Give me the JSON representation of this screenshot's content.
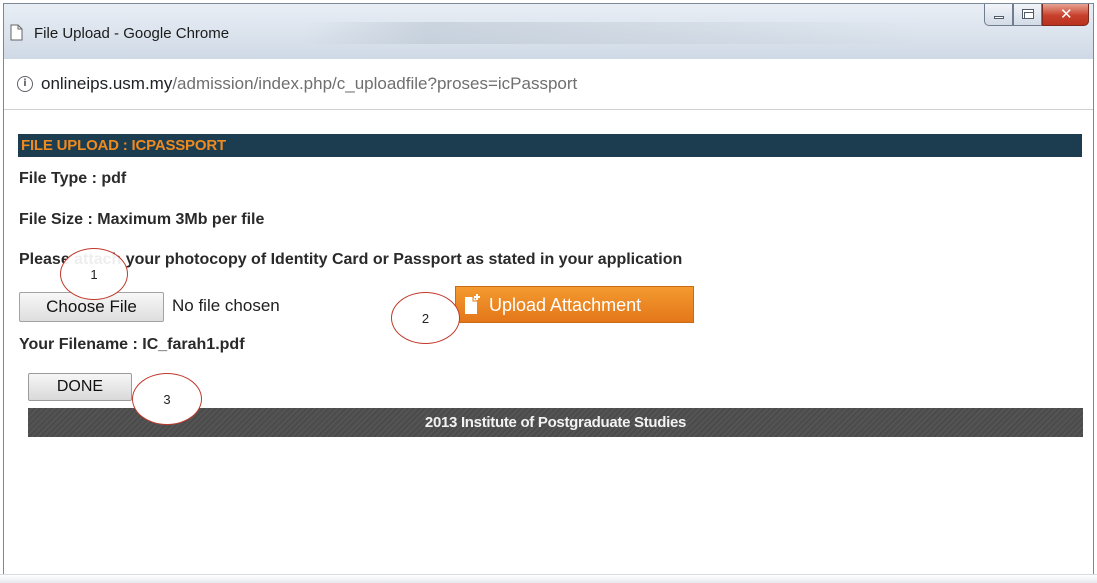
{
  "window": {
    "title": "File Upload - Google Chrome"
  },
  "address_bar": {
    "domain": "onlineips.usm.my",
    "path": "/admission/index.php/c_uploadfile?proses=icPassport"
  },
  "upload_form": {
    "header": "FILE UPLOAD : ICPASSPORT",
    "file_type": "File Type : pdf",
    "file_size": "File Size : Maximum 3Mb per file",
    "instruction": "Please attach your photocopy of Identity Card or Passport as stated in your application",
    "choose_file_label": "Choose File",
    "no_file_text": "No file chosen",
    "upload_label": "Upload Attachment",
    "filename_line": "Your Filename : IC_farah1.pdf",
    "done_label": "DONE"
  },
  "footer": {
    "text": "2013 Institute of Postgraduate Studies"
  },
  "callouts": [
    "1",
    "2",
    "3"
  ],
  "colors": {
    "header_bg": "#1c3c50",
    "header_text": "#ee8a1e",
    "upload_button": "#f0891f",
    "footer_bg": "#4b4b4b",
    "callout_border": "#c0392b"
  },
  "icons": {
    "tab": "page-icon",
    "site_info": "info-icon",
    "upload": "file-add-icon"
  }
}
